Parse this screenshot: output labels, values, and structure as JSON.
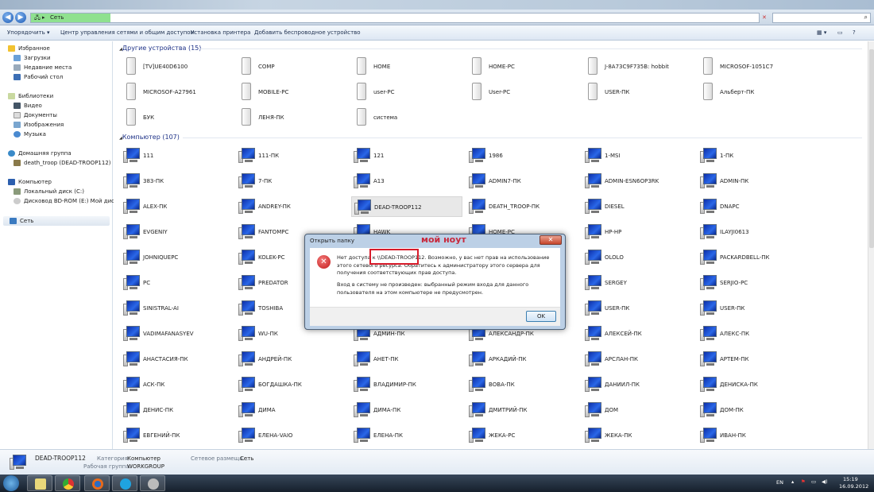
{
  "address": {
    "path": [
      "Сеть"
    ],
    "search_placeholder": ""
  },
  "toolbar": {
    "items": [
      "Упорядочить ▾",
      "Центр управления сетями и общим доступом",
      "Установка принтера",
      "Добавить беспроводное устройство"
    ]
  },
  "sidebar": {
    "favorites": "Избранное",
    "fav_items": [
      "Загрузки",
      "Недавние места",
      "Рабочий стол"
    ],
    "libraries": "Библиотеки",
    "lib_items": [
      "Видео",
      "Документы",
      "Изображения",
      "Музыка"
    ],
    "homegroup": "Домашняя группа",
    "home_items": [
      "death_troop (DEAD-TROOP112)"
    ],
    "computer": "Компьютер",
    "comp_items": [
      "Локальный диск (C:)",
      "Дисковод BD-ROM (E:) Мой диск"
    ],
    "network": "Сеть"
  },
  "groups": {
    "other_devices": {
      "title": "Другие устройства (15)",
      "items": [
        "[TV]UE40D6100",
        "COMP",
        "HOME",
        "HOME-PC",
        "J-8A73C9F735B: hobbit",
        "MICROSOF-1051C7",
        "MICROSOF-A27961",
        "MOBILE-PC",
        "user-PC",
        "User-PC",
        "USER-ПК",
        "Альберт-ПК",
        "БУК",
        "ЛЕНЯ-ПК",
        "система"
      ]
    },
    "computers": {
      "title": "Компьютер (107)",
      "selected": "DEAD-TROOP112",
      "items": [
        "111",
        "111-ПК",
        "121",
        "1986",
        "1-MSI",
        "1-ПК",
        "383-ПК",
        "7-ПК",
        "A13",
        "ADMIN7-ПК",
        "ADMIN-ESN6OP3RK",
        "ADMIN-ПК",
        "ALEX-ПК",
        "ANDREY-ПК",
        "DEAD-TROOP112",
        "DEATH_TROOP-ПК",
        "DIESEL",
        "DNAPC",
        "EVGENIY",
        "FANTOMPC",
        "HAWK",
        "HOME-PC",
        "HP-HP",
        "ILAYJI0613",
        "JOHNIQUEPC",
        "KOLEK-PC",
        "",
        "",
        "OLOLO",
        "PACKARDBELL-ПК",
        "PC",
        "PREDATOR",
        "",
        "",
        "SERGEY",
        "SERJIO-PC",
        "SINISTRAL-AI",
        "TOSHIBA",
        "",
        "",
        "USER-ПК",
        "USER-ПК",
        "VADIMAFANASYEV",
        "WU-ПК",
        "АДМИН-ПК",
        "АЛЕКСАНДР-ПК",
        "АЛЕКСЕЙ-ПК",
        "АЛЕКС-ПК",
        "АНАСТАСИЯ-ПК",
        "АНДРЕЙ-ПК",
        "АНЕТ-ПК",
        "АРКАДИЙ-ПК",
        "АРСЛАН-ПК",
        "АРТЕМ-ПК",
        "АСК-ПК",
        "БОГДАШКА-ПК",
        "ВЛАДИМИР-ПК",
        "ВОВА-ПК",
        "ДАНИИЛ-ПК",
        "ДЕНИСКА-ПК",
        "ДЕНИС-ПК",
        "ДИМА",
        "ДИМА-ПК",
        "ДМИТРИЙ-ПК",
        "ДОМ",
        "ДОМ-ПК",
        "ЕВГЕНИЙ-ПК",
        "ЕЛЕНА-VAIO",
        "ЕЛЕНА-ПК",
        "ЖЕКА-PC",
        "ЖЕКА-ПК",
        "ИВАН-ПК"
      ]
    }
  },
  "details": {
    "name": "DEAD-TROOP112",
    "category_label": "Категория:",
    "category": "Компьютер",
    "workgroup_label": "Рабочая группа:",
    "workgroup": "WORKGROUP",
    "location_label": "Сетевое размеща...",
    "location": "Сеть"
  },
  "dialog": {
    "title": "Открыть папку",
    "message1": "Нет доступа к \\\\DEAD-TROOP112. Возможно, у вас нет прав на использование этого сетевого ресурса. Обратитесь к администратору этого сервера для получения соответствующих прав доступа.",
    "message2": "Вход в систему не произведен: выбранный режим входа для данного пользователя на этом компьютере не предусмотрен.",
    "ok": "OK"
  },
  "annotation": "мой ноут",
  "tray": {
    "lang": "EN",
    "time": "15:19",
    "date": "16.09.2012"
  },
  "colors": {
    "annotation": "#d81c2b",
    "selection": "#e8e8e8"
  }
}
